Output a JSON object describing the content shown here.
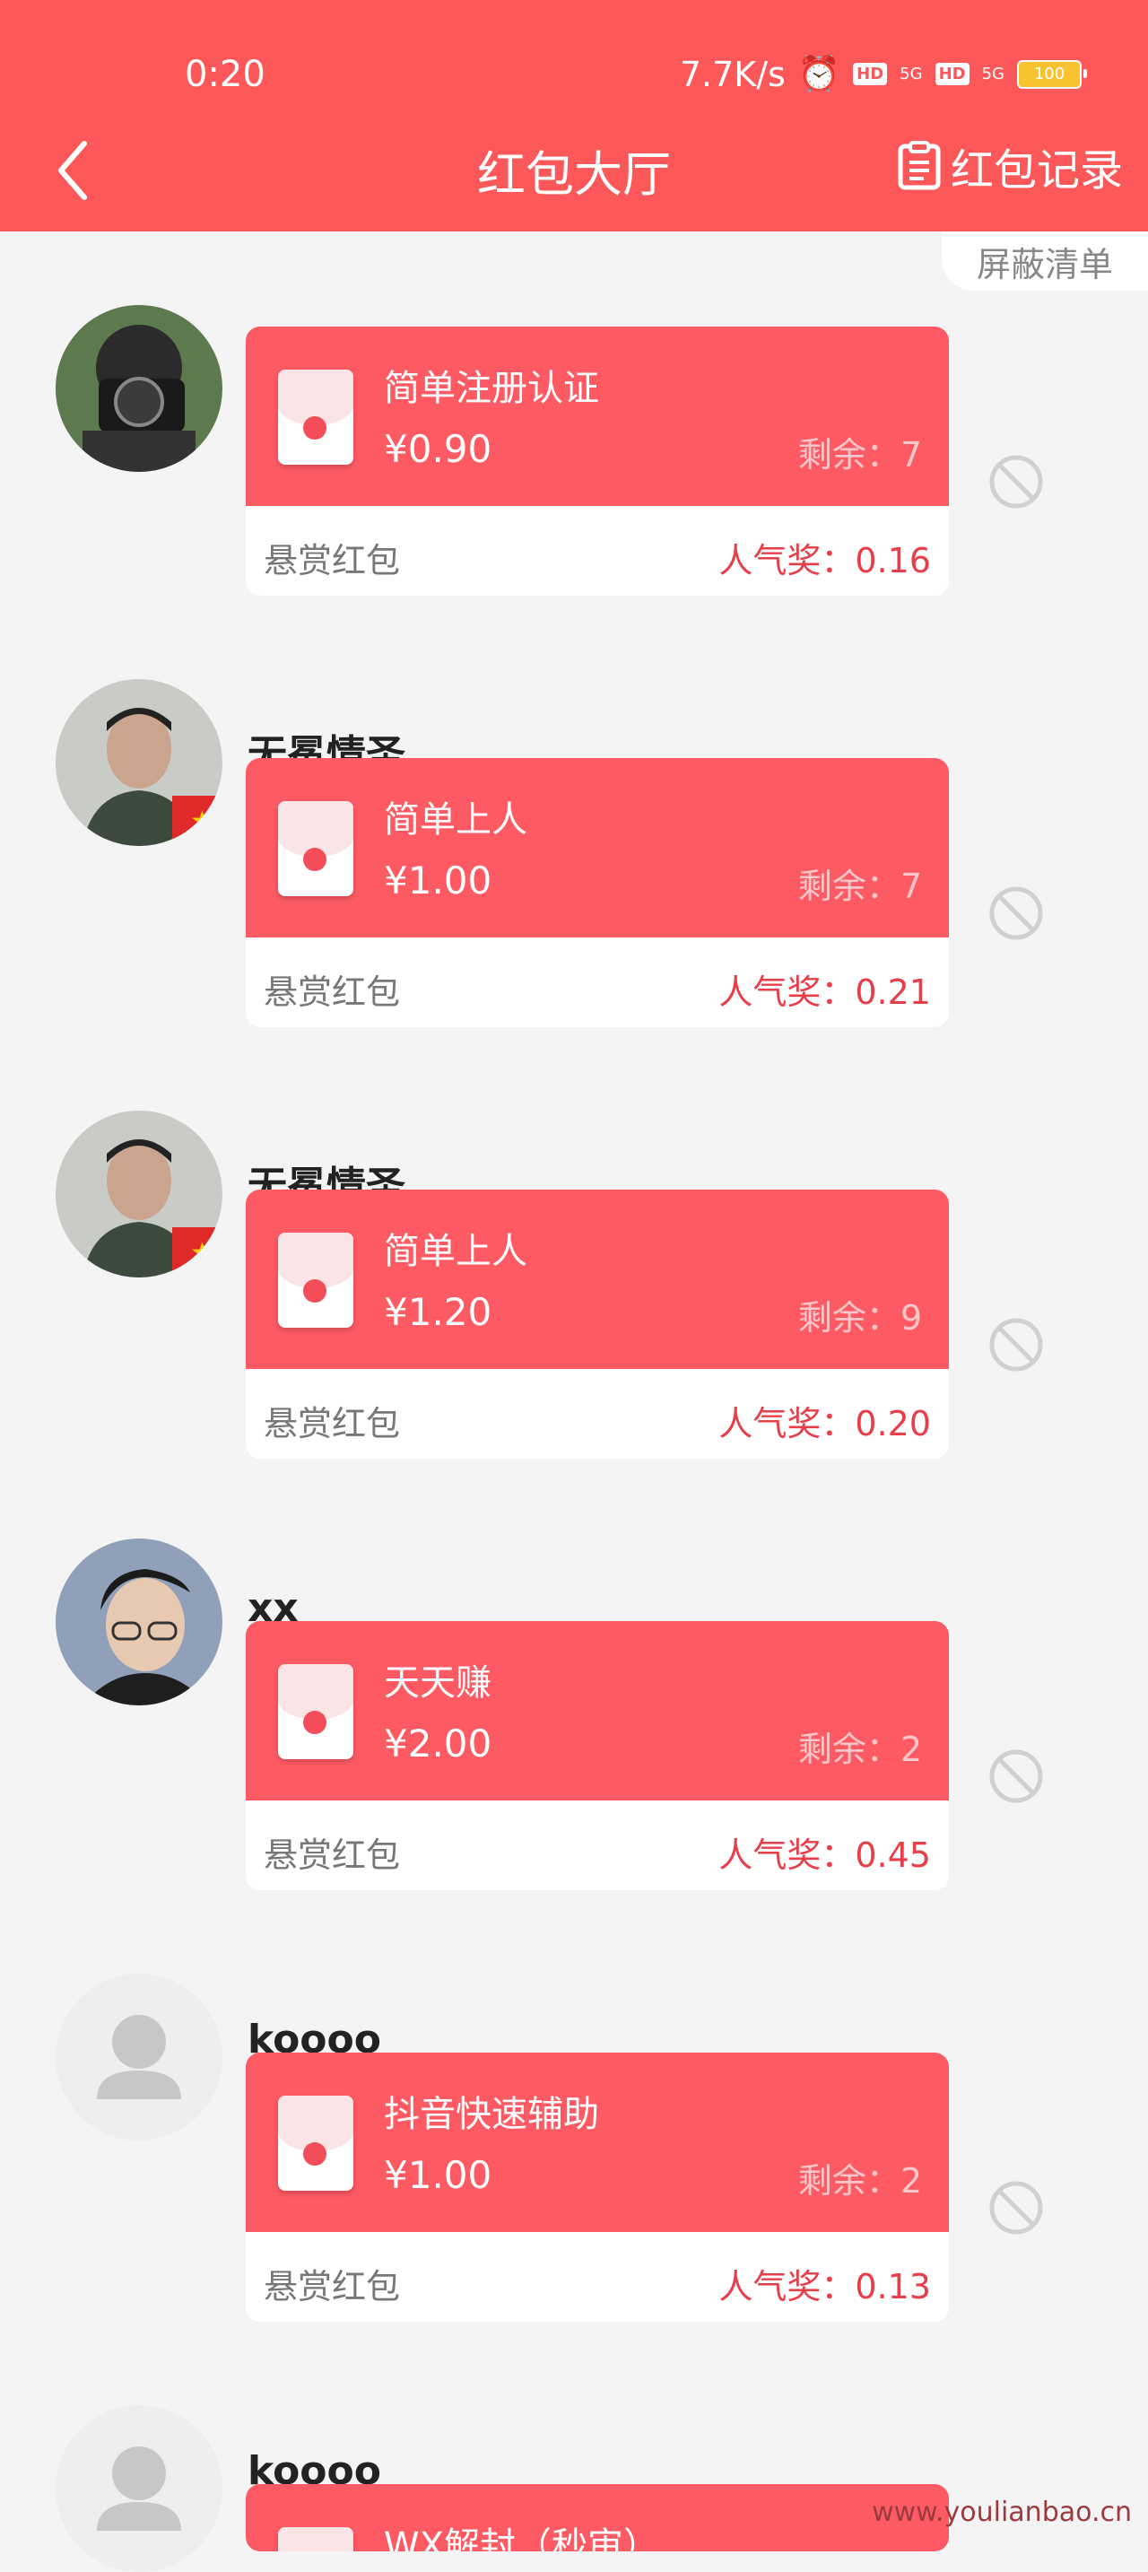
{
  "status_bar": {
    "time": "0:20",
    "net_speed": "7.7K/s",
    "hd_label": "HD",
    "net_label": "5G",
    "battery": "100"
  },
  "header": {
    "title": "红包大厅",
    "record_label": "红包记录",
    "block_list_label": "屏蔽清单"
  },
  "items": [
    {
      "username": "",
      "name": "简单注册认证",
      "amount": "¥0.90",
      "left": "剩余：7",
      "type": "悬赏红包",
      "popularity": "人气奖：0.16"
    },
    {
      "username": "无冕情圣",
      "name": "简单上人",
      "amount": "¥1.00",
      "left": "剩余：7",
      "type": "悬赏红包",
      "popularity": "人气奖：0.21"
    },
    {
      "username": "无冕情圣",
      "name": "简单上人",
      "amount": "¥1.20",
      "left": "剩余：9",
      "type": "悬赏红包",
      "popularity": "人气奖：0.20"
    },
    {
      "username": "xx",
      "name": "天天赚",
      "amount": "¥2.00",
      "left": "剩余：2",
      "type": "悬赏红包",
      "popularity": "人气奖：0.45"
    },
    {
      "username": "koooo",
      "name": "抖音快速辅助",
      "amount": "¥1.00",
      "left": "剩余：2",
      "type": "悬赏红包",
      "popularity": "人气奖：0.13"
    },
    {
      "username": "koooo",
      "name": "WX解封（秒审）"
    }
  ],
  "watermark": "www.youlianbao.cn",
  "colors": {
    "primary": "#fd5859",
    "card": "#fd5a63",
    "popularity": "#e83e49"
  }
}
